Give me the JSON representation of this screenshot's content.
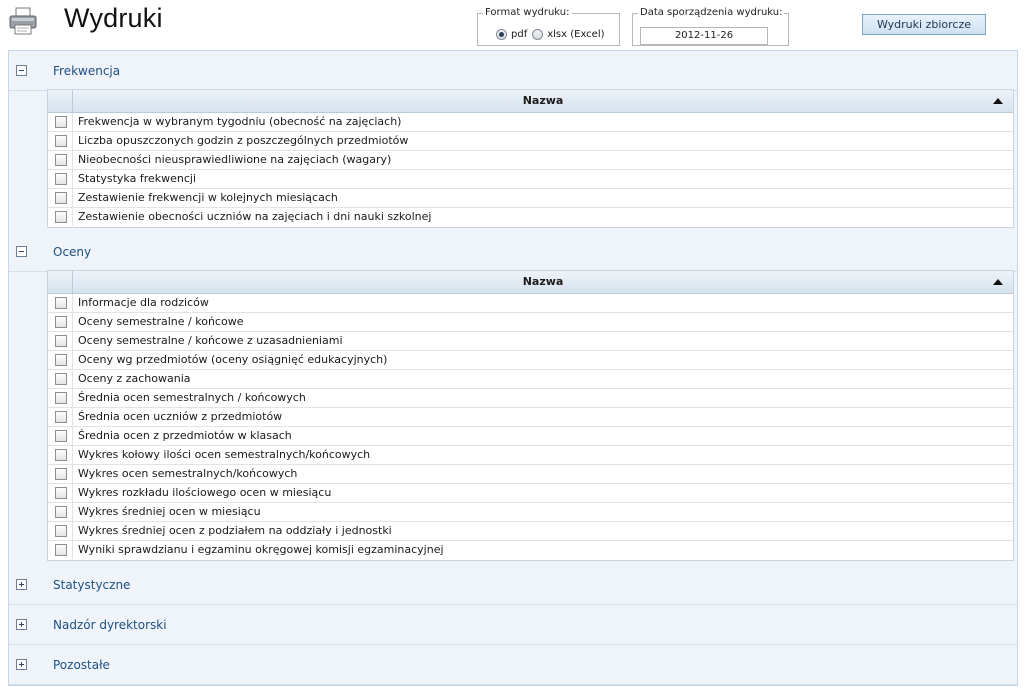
{
  "header": {
    "title": "Wydruki",
    "printer_icon": "printer-icon"
  },
  "format": {
    "legend": "Format wydruku:",
    "options": [
      {
        "label": "pdf",
        "checked": true
      },
      {
        "label": "xlsx (Excel)",
        "checked": false
      }
    ]
  },
  "date": {
    "legend": "Data sporządzenia wydruku:",
    "value": "2012-11-26"
  },
  "actions": {
    "zbiorcze_label": "Wydruki zbiorcze"
  },
  "grid_header": "Nazwa",
  "sections": [
    {
      "title": "Frekwencja",
      "expanded": true,
      "items": [
        "Frekwencja w wybranym tygodniu (obecność na zajęciach)",
        "Liczba opuszczonych godzin z poszczególnych przedmiotów",
        "Nieobecności nieusprawiedliwione na zajęciach (wagary)",
        "Statystyka frekwencji",
        "Zestawienie frekwencji w kolejnych miesiącach",
        "Zestawienie obecności uczniów na zajęciach i dni nauki szkolnej"
      ]
    },
    {
      "title": "Oceny",
      "expanded": true,
      "items": [
        "Informacje dla rodziców",
        "Oceny semestralne / końcowe",
        "Oceny semestralne / końcowe z uzasadnieniami",
        "Oceny wg przedmiotów (oceny osiągnięć edukacyjnych)",
        "Oceny z zachowania",
        "Średnia ocen semestralnych / końcowych",
        "Średnia ocen uczniów z przedmiotów",
        "Średnia ocen z przedmiotów w klasach",
        "Wykres kołowy ilości ocen semestralnych/końcowych",
        "Wykres ocen semestralnych/końcowych",
        "Wykres rozkładu ilościowego ocen w miesiącu",
        "Wykres średniej ocen w miesiącu",
        "Wykres średniej ocen z podziałem na oddziały i jednostki",
        "Wyniki sprawdzianu i egzaminu okręgowej komisji egzaminacyjnej"
      ]
    },
    {
      "title": "Statystyczne",
      "expanded": false,
      "items": []
    },
    {
      "title": "Nadzór dyrektorski",
      "expanded": false,
      "items": []
    },
    {
      "title": "Pozostałe",
      "expanded": false,
      "items": []
    }
  ]
}
